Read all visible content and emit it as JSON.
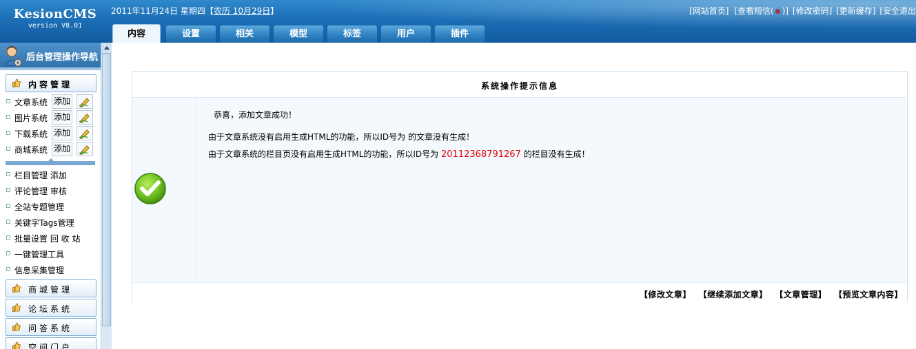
{
  "header": {
    "logo_name": "KesionCMS",
    "logo_version": "version V8.01",
    "date": "2011年11月24日 星期四",
    "lunar_prefix": "【",
    "lunar": "农历 10月29日",
    "lunar_suffix": "】",
    "links": [
      "[网站首页]",
      "[查看短信(",
      ")]",
      "[修改密码]",
      "[更新缓存]",
      "[安全退出"
    ],
    "tabs": [
      "内容",
      "设置",
      "相关",
      "模型",
      "标签",
      "用户",
      "插件"
    ],
    "active_tab": "内容"
  },
  "sidebar": {
    "title": "后台管理操作导航",
    "content_section": "内容管理",
    "systems": [
      {
        "label": "文章系统",
        "add": "添加"
      },
      {
        "label": "图片系统",
        "add": "添加"
      },
      {
        "label": "下载系统",
        "add": "添加"
      },
      {
        "label": "商城系统",
        "add": "添加"
      }
    ],
    "nav": [
      "栏目管理 添加",
      "评论管理 审核",
      "全站专题管理",
      "关键字Tags管理",
      "批量设置 回 收 站",
      "一键管理工具",
      "信息采集管理"
    ],
    "sections": [
      "商城管理",
      "论坛系统",
      "问答系统",
      "空间门户"
    ]
  },
  "main": {
    "box_title": "系统操作提示信息",
    "success": "恭喜，添加文章成功！",
    "line1": "由于文章系统没有启用生成HTML的功能，所以ID号为 的文章没有生成！",
    "line2_prefix": "由于文章系统的栏目页没有启用生成HTML的功能，所以ID号为 ",
    "line2_id": "20112368791267",
    "line2_suffix": " 的栏目没有生成！",
    "actions": [
      "【修改文章】",
      "【继续添加文章】",
      "【文章管理】",
      "【预览文章内容】"
    ]
  },
  "colors": {
    "header": "#1d6fb6",
    "accent_red": "#e0000a",
    "check_green": "#6cbf20"
  },
  "icons": {
    "success": "check-circle-icon",
    "thumb": "thumbs-up-icon",
    "edit": "pencil-edit-icon"
  }
}
